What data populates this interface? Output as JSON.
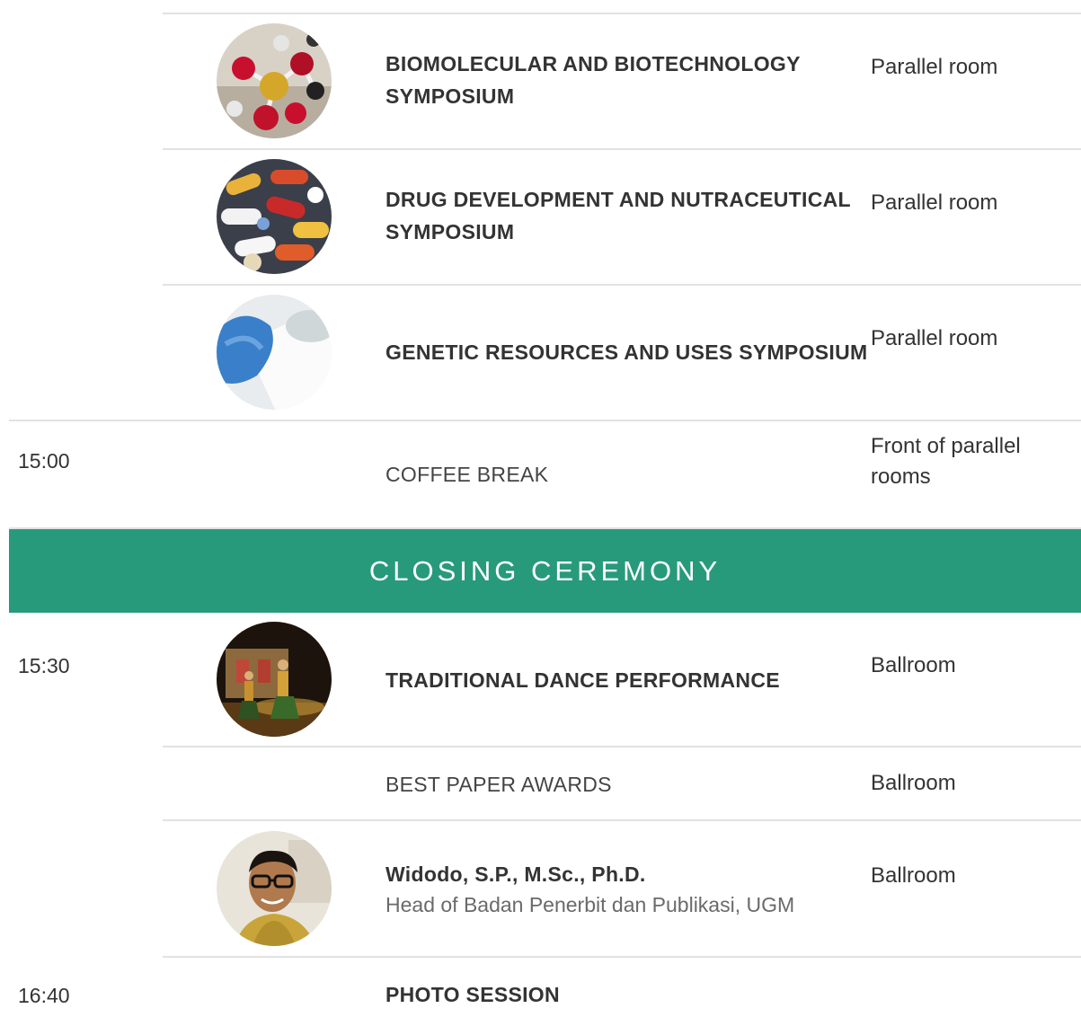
{
  "rows": [
    {
      "title": "BIOMOLECULAR AND BIOTECHNOLOGY SYMPOSIUM",
      "venue": "Parallel room",
      "image": "molecule-model-image"
    },
    {
      "title": "DRUG DEVELOPMENT AND NUTRACEUTICAL SYMPOSIUM",
      "venue": "Parallel room",
      "image": "pills-capsules-image"
    },
    {
      "title": "GENETIC RESOURCES AND USES SYMPOSIUM",
      "venue": "Parallel room",
      "image": "lab-glove-petri-image"
    },
    {
      "time": "15:00",
      "title": "COFFEE BREAK",
      "venue": "Front of parallel rooms"
    }
  ],
  "closing": {
    "banner": "CLOSING CEREMONY",
    "rows": [
      {
        "time": "15:30",
        "title": "TRADITIONAL DANCE PERFORMANCE",
        "venue": "Ballroom",
        "image": "dance-performance-image"
      },
      {
        "title": "BEST PAPER AWARDS",
        "venue": "Ballroom"
      },
      {
        "title": "Widodo, S.P., M.Sc., Ph.D.",
        "subtitle": "Head of Badan Penerbit dan Publikasi, UGM",
        "venue": "Ballroom",
        "image": "speaker-photo"
      },
      {
        "time": "16:40",
        "title": "PHOTO SESSION"
      }
    ]
  },
  "colors": {
    "banner": "#289a7c",
    "divider": "#e2e2e2",
    "text": "#333333"
  }
}
